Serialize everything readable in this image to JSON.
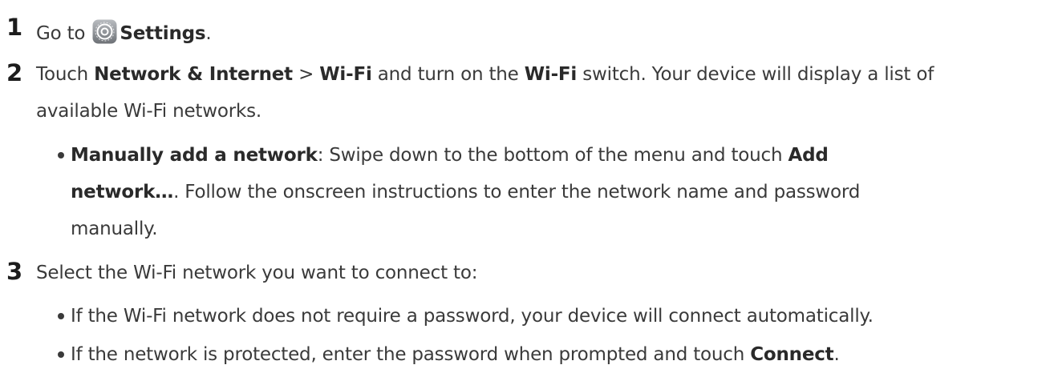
{
  "steps": [
    {
      "number": "1",
      "lines": [
        {
          "pre": "Go to ",
          "icon": "settings-gear-icon",
          "bold": "Settings",
          "post": "."
        }
      ]
    },
    {
      "number": "2",
      "line1": {
        "t1": "Touch ",
        "b1": "Network & Internet",
        "t2": " > ",
        "b2": "Wi-Fi",
        "t3": " and turn on the ",
        "b3": "Wi-Fi",
        "t4": " switch. Your device will display a list of"
      },
      "line2": "available Wi-Fi networks.",
      "bullet": {
        "bold_lead": "Manually add a network",
        "line1_rest": ": Swipe down to the bottom of the menu and touch ",
        "line1_bold": "Add",
        "line2_bold": "network…",
        "line2_rest": ". Follow the onscreen instructions to enter the network name and password",
        "line3": "manually."
      }
    },
    {
      "number": "3",
      "line1": "Select the Wi-Fi network you want to connect to:",
      "bullets": [
        {
          "text": "If the Wi-Fi network does not require a password, your device will connect automatically."
        },
        {
          "text": "If the network is protected, enter the password when prompted and touch ",
          "bold": "Connect",
          "post": "."
        }
      ]
    }
  ]
}
